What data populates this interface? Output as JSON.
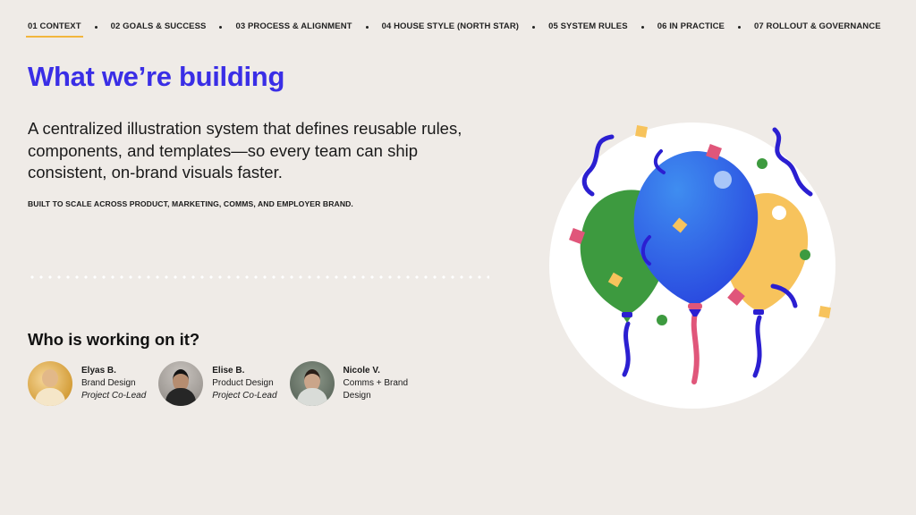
{
  "nav": {
    "items": [
      {
        "label": "01 CONTEXT",
        "active": true
      },
      {
        "label": "02 GOALS & SUCCESS",
        "active": false
      },
      {
        "label": "03 PROCESS & ALIGNMENT",
        "active": false
      },
      {
        "label": "04 HOUSE STYLE (NORTH STAR)",
        "active": false
      },
      {
        "label": "05 SYSTEM RULES",
        "active": false
      },
      {
        "label": "06 IN PRACTICE",
        "active": false
      },
      {
        "label": "07 ROLLOUT & GOVERNANCE",
        "active": false
      }
    ]
  },
  "hero": {
    "title": "What we’re building",
    "lead": "A centralized illustration system that defines reusable rules, components, and templates—so every team can ship consistent, on-brand visuals faster.",
    "kicker": "BUILT TO SCALE ACROSS PRODUCT, MARKETING, COMMS, AND EMPLOYER BRAND."
  },
  "team": {
    "heading": "Who is working on it?",
    "people": [
      {
        "name": "Elyas B.",
        "role": "Brand Design",
        "role2": "Project Co-Lead"
      },
      {
        "name": "Elise B.",
        "role": "Product Design",
        "role2": "Project Co-Lead"
      },
      {
        "name": "Nicole V.",
        "role": "Comms + Brand Design",
        "role2": ""
      }
    ]
  },
  "illustration": {
    "icon": "balloons-illustration",
    "colors": {
      "accent": "#3a2ee6",
      "underline": "#f2b63d",
      "blue": "#2f5de8",
      "green": "#3d9a3f",
      "yellow": "#f7c35c",
      "pink": "#e0567a",
      "navy": "#2b1fd1"
    }
  }
}
